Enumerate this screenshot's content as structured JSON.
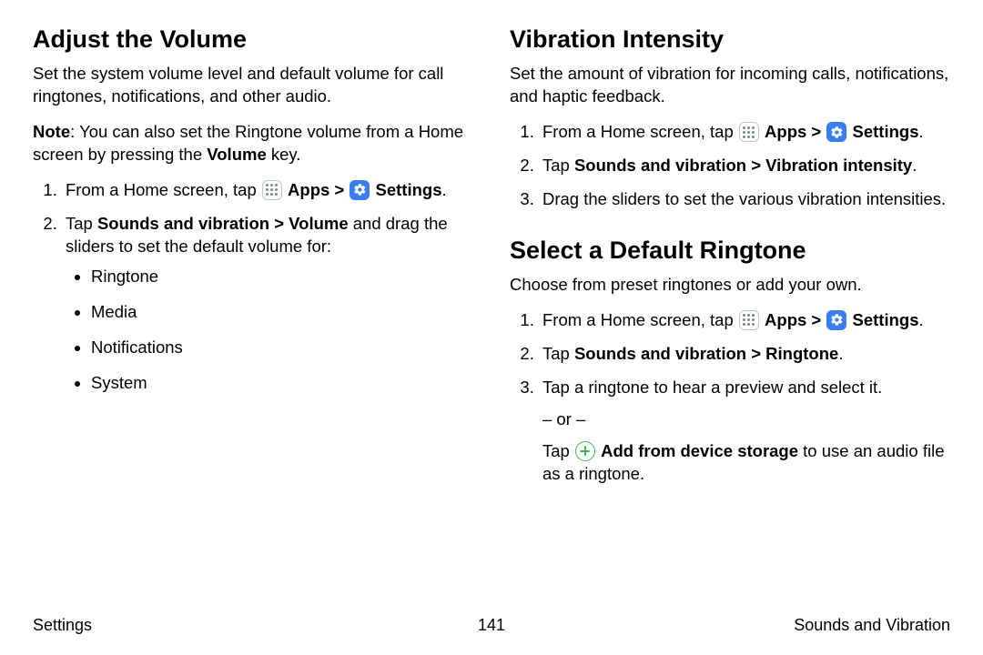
{
  "left": {
    "heading": "Adjust the Volume",
    "intro": "Set the system volume level and default volume for call ringtones, notifications, and other audio.",
    "note_label": "Note",
    "note_text1": ": You can also set the Ringtone volume from a Home screen by pressing the ",
    "note_bold": "Volume",
    "note_text2": " key.",
    "step1_a": "From a Home screen, tap ",
    "apps_label": "Apps",
    "caret": ">",
    "settings_label": "Settings",
    "period": ".",
    "step2_a": "Tap ",
    "step2_bold": "Sounds and vibration > Volume",
    "step2_b": " and drag the sliders to set the default volume for:",
    "bullets": [
      "Ringtone",
      "Media",
      "Notifications",
      "System"
    ]
  },
  "right_a": {
    "heading": "Vibration Intensity",
    "intro": "Set the amount of vibration for incoming calls, notifications, and haptic feedback.",
    "step1_a": "From a Home screen, tap ",
    "step2_a": "Tap ",
    "step2_bold": "Sounds and vibration > Vibration intensity",
    "step3": "Drag the sliders to set the various vibration intensities."
  },
  "right_b": {
    "heading": "Select a Default Ringtone",
    "intro": "Choose from preset ringtones or add your own.",
    "step1_a": "From a Home screen, tap ",
    "step2_a": "Tap ",
    "step2_bold": "Sounds and vibration > Ringtone",
    "step3": "Tap a ringtone to hear a preview and select it.",
    "or": "– or –",
    "step3b_a": "Tap ",
    "step3b_bold": "Add from device storage",
    "step3b_b": " to use an audio file as a ringtone."
  },
  "shared": {
    "apps_label": "Apps",
    "caret": ">",
    "settings_label": "Settings",
    "period": "."
  },
  "footer": {
    "left": "Settings",
    "center": "141",
    "right": "Sounds and Vibration"
  }
}
